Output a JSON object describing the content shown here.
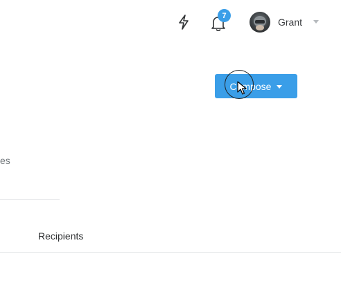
{
  "header": {
    "notifications_count": "7",
    "user_name": "Grant",
    "icons": {
      "activity": "lightning-bolt-icon",
      "notifications": "bell-icon",
      "user_menu": "chevron-down-icon"
    }
  },
  "main": {
    "compose_label": "Compose",
    "partial_label": "es",
    "table": {
      "columns": [
        "Recipients"
      ]
    }
  },
  "colors": {
    "accent": "#3a9ee8",
    "divider": "#e6e8ea",
    "text": "#2f3133"
  }
}
